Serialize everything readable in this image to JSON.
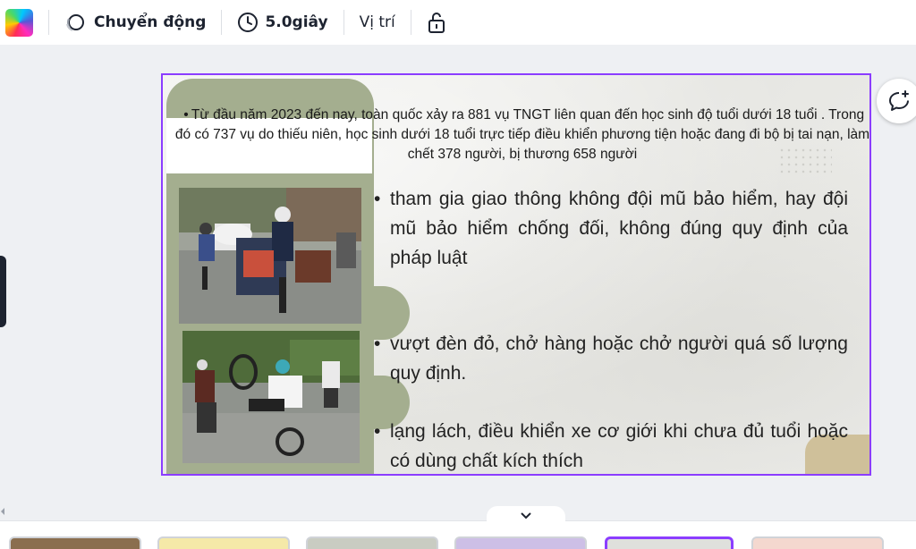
{
  "toolbar": {
    "animate_label": "Chuyển động",
    "duration_label": "5.0giây",
    "position_label": "Vị trí",
    "icons": [
      "color-picker-icon",
      "animate-icon",
      "clock-icon",
      "lock-open-icon"
    ]
  },
  "slide": {
    "top_bullet": "Từ đầu năm 2023 đến nay, toàn quốc xảy ra 881 vụ TNGT liên quan đến học sinh độ tuổi dưới 18 tuổi . Trong đó có 737 vụ do thiếu niên, học sinh dưới 18 tuổi trực tiếp điều khiển phương tiện hoặc đang đi bộ bị tai nạn, làm chết 378 người, bị thương 658 người",
    "bullet_1": " tham gia giao thông không đội mũ bảo hiểm, hay đội mũ bảo hiểm chống đối, không đúng quy định của pháp luật",
    "bullet_2": "vượt đèn đỏ, chở hàng hoặc chở người quá số lượng quy định.",
    "bullet_3": "lạng lách, điều khiển xe cơ giới khi chưa đủ tuổi hoặc có dùng chất kích thích"
  },
  "colors": {
    "selection": "#8b3dff",
    "sage": "#a4ae8f",
    "tan": "#cfc09a"
  }
}
